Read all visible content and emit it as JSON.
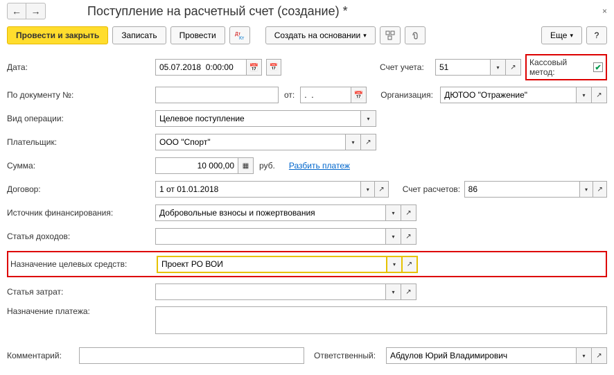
{
  "header": {
    "title": "Поступление на расчетный счет (создание) *"
  },
  "toolbar": {
    "post_close": "Провести и закрыть",
    "save": "Записать",
    "post": "Провести",
    "create_based": "Создать на основании",
    "more": "Еще"
  },
  "labels": {
    "date": "Дата:",
    "account": "Счет учета:",
    "cash_method": "Кассовый метод:",
    "by_doc": "По документу №:",
    "from": "от:",
    "org": "Организация:",
    "op_type": "Вид операции:",
    "payer": "Плательщик:",
    "sum": "Сумма:",
    "currency": "руб.",
    "split": "Разбить платеж",
    "contract": "Договор:",
    "settle_acc": "Счет расчетов:",
    "fin_source": "Источник финансирования:",
    "income_item": "Статья доходов:",
    "target_funds": "Назначение целевых средств:",
    "expense_item": "Статья затрат:",
    "payment_purpose": "Назначение платежа:",
    "comment": "Комментарий:",
    "responsible": "Ответственный:"
  },
  "values": {
    "date": "05.07.2018  0:00:00",
    "account": "51",
    "by_doc_num": "",
    "by_doc_date": ".  .",
    "org": "ДЮТОО \"Отражение\"",
    "op_type": "Целевое поступление",
    "payer": "ООО \"Спорт\"",
    "sum": "10 000,00",
    "contract": "1 от 01.01.2018",
    "settle_acc": "86",
    "fin_source": "Добровольные взносы и пожертвования",
    "income_item": "",
    "target_funds": "Проект РО ВОИ",
    "expense_item": "",
    "payment_purpose": "",
    "comment": "",
    "responsible": "Абдулов Юрий Владимирович"
  }
}
